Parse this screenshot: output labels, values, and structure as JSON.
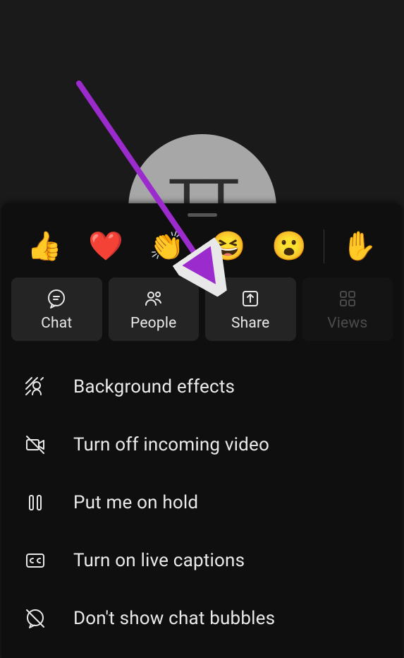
{
  "avatar_initials": "TT",
  "reactions": [
    {
      "name": "thumbs-up",
      "emoji": "👍"
    },
    {
      "name": "heart",
      "emoji": "❤️"
    },
    {
      "name": "applause",
      "emoji": "👏"
    },
    {
      "name": "laugh",
      "emoji": "😆"
    },
    {
      "name": "surprised",
      "emoji": "😮"
    },
    {
      "name": "raise-hand",
      "emoji": "✋"
    }
  ],
  "actions": {
    "chat": {
      "label": "Chat"
    },
    "people": {
      "label": "People"
    },
    "share": {
      "label": "Share"
    },
    "views": {
      "label": "Views"
    }
  },
  "menu": {
    "background_effects": {
      "label": "Background effects"
    },
    "incoming_video": {
      "label": "Turn off incoming video"
    },
    "hold": {
      "label": "Put me on hold"
    },
    "live_captions": {
      "label": "Turn on live captions"
    },
    "chat_bubbles": {
      "label": "Don't show chat bubbles"
    }
  },
  "annotation_color": "#9b2bcc"
}
